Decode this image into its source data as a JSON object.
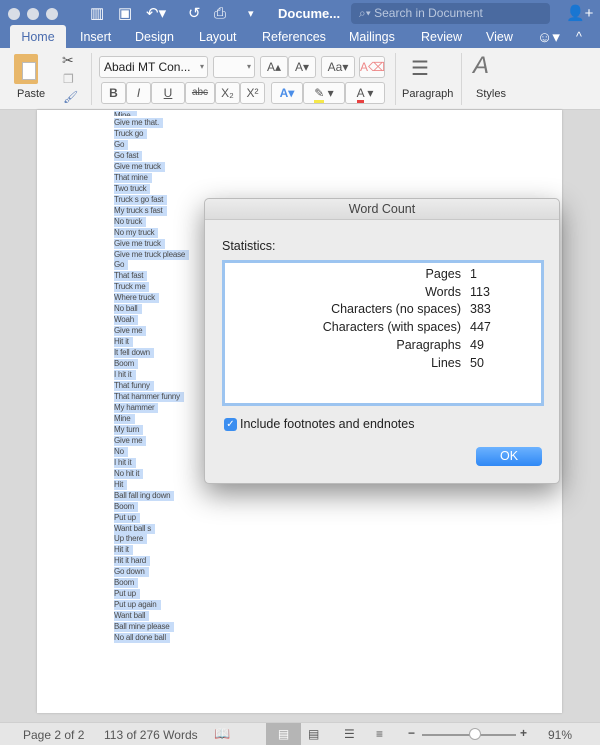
{
  "window": {
    "title": "Docume...",
    "search_placeholder": "Search in Document"
  },
  "tabs": [
    "Home",
    "Insert",
    "Design",
    "Layout",
    "References",
    "Mailings",
    "Review",
    "View"
  ],
  "ribbon": {
    "paste": "Paste",
    "font_name": "Abadi MT Con...",
    "font_size": "",
    "bold": "B",
    "italic": "I",
    "underline": "U",
    "strike": "abc",
    "subscript": "X₂",
    "superscript": "X²",
    "grow": "A▴",
    "shrink": "A▾",
    "paragraph": "Paragraph",
    "styles": "Styles",
    "highlight_color": "#f5e84a",
    "font_color": "#e84040"
  },
  "document": {
    "partial_first_line": "Mine.",
    "lines": [
      "Give me that.",
      "Truck go",
      "Go",
      "Go fast",
      "Give me truck",
      "That mine",
      "Two truck",
      "Truck s go fast",
      "My truck s fast",
      "No truck",
      "No my truck",
      "Give me truck",
      "Give me truck please",
      "Go",
      "That fast",
      "Truck me",
      "Where truck",
      "No ball",
      "Woah",
      "Give me",
      "Hit it",
      "It fell down",
      "Boom",
      "I hit it",
      "That funny",
      "That hammer funny",
      "My hammer",
      "Mine",
      "My turn",
      "Give me",
      "No",
      "I hit it",
      "No hit it",
      "Hit",
      "Ball fall ing down",
      "Boom",
      "Put up",
      "Want ball s",
      "Up there",
      "Hit it",
      "Hit it hard",
      "Go down",
      "Boom",
      "Put up",
      "Put up again",
      "Want ball",
      "Ball mine please",
      "No all done ball"
    ],
    "selection_color": "#c7dcf8"
  },
  "dialog": {
    "title": "Word Count",
    "section": "Statistics:",
    "stats": [
      {
        "label": "Pages",
        "value": "1"
      },
      {
        "label": "Words",
        "value": "113"
      },
      {
        "label": "Characters (no spaces)",
        "value": "383"
      },
      {
        "label": "Characters (with spaces)",
        "value": "447"
      },
      {
        "label": "Paragraphs",
        "value": "49"
      },
      {
        "label": "Lines",
        "value": "50"
      }
    ],
    "checkbox_label": "Include footnotes and endnotes",
    "checkbox_checked": true,
    "ok": "OK"
  },
  "statusbar": {
    "page": "Page 2 of 2",
    "words": "113 of 276 Words",
    "zoom": "91%",
    "zoom_percent": 91
  }
}
